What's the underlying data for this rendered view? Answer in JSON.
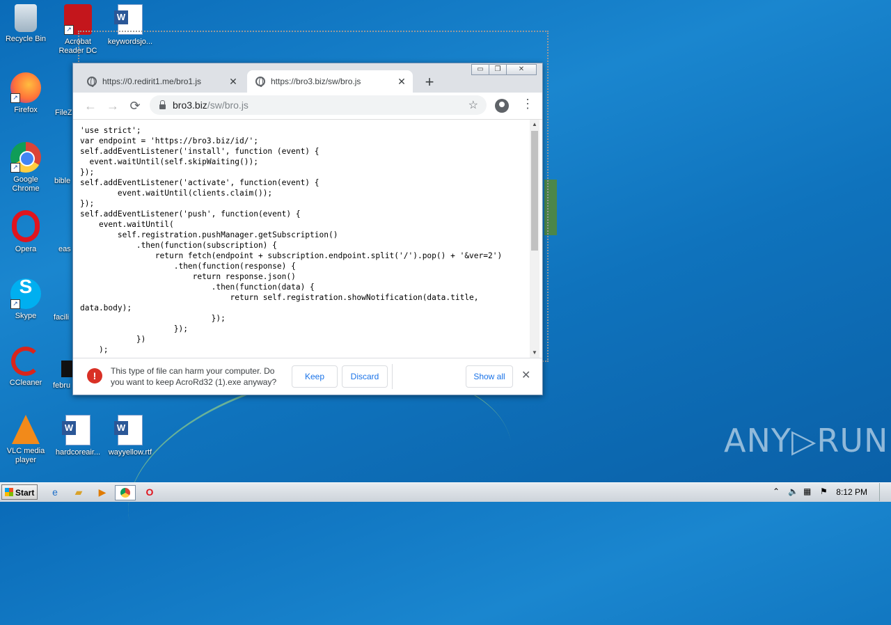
{
  "desktop": {
    "icons": [
      {
        "label": "Recycle Bin",
        "icon": "recycle-bin-icon"
      },
      {
        "label": "Acrobat Reader DC",
        "icon": "acrobat-icon"
      },
      {
        "label": "keywordsjo...",
        "icon": "word-doc-icon"
      },
      {
        "label": "Firefox",
        "icon": "firefox-icon"
      },
      {
        "label": "FileZ",
        "icon": "filezilla-icon"
      },
      {
        "label": "Google Chrome",
        "icon": "chrome-icon"
      },
      {
        "label": "bible",
        "icon": "word-doc-icon"
      },
      {
        "label": "Opera",
        "icon": "opera-icon"
      },
      {
        "label": "eas",
        "icon": "word-doc-icon"
      },
      {
        "label": "Skype",
        "icon": "skype-icon"
      },
      {
        "label": "facili",
        "icon": "word-doc-icon"
      },
      {
        "label": "CCleaner",
        "icon": "ccleaner-icon"
      },
      {
        "label": "febru",
        "icon": "file-icon"
      },
      {
        "label": "VLC media player",
        "icon": "vlc-icon"
      },
      {
        "label": "hardcoreair...",
        "icon": "word-doc-icon"
      },
      {
        "label": "wayyellow.rtf",
        "icon": "word-doc-icon"
      }
    ]
  },
  "browser": {
    "window_controls": {
      "minimize": "▭",
      "restore": "❐",
      "close": "✕"
    },
    "tabs": [
      {
        "title": "https://0.redirit1.me/bro1.js",
        "close": "✕"
      },
      {
        "title": "https://bro3.biz/sw/bro.js",
        "close": "✕"
      }
    ],
    "new_tab": "+",
    "nav": {
      "back": "←",
      "forward": "→",
      "reload": "⟳",
      "bookmark": "☆",
      "menu": "⋮"
    },
    "url_host": "bro3.biz",
    "url_path": "/sw/bro.js",
    "code": "'use strict';\nvar endpoint = 'https://bro3.biz/id/';\nself.addEventListener('install', function (event) {\n  event.waitUntil(self.skipWaiting());\n});\nself.addEventListener('activate', function(event) {\n        event.waitUntil(clients.claim());\n});\nself.addEventListener('push', function(event) {\n    event.waitUntil(\n        self.registration.pushManager.getSubscription()\n            .then(function(subscription) {\n                return fetch(endpoint + subscription.endpoint.split('/').pop() + '&ver=2')\n                    .then(function(response) {\n                        return response.json()\n                            .then(function(data) {\n                                return self.registration.showNotification(data.title, data.body);\n                            });\n                    });\n            })\n    );",
    "download_bar": {
      "message": "This type of file can harm your computer. Do you want to keep AcroRd32 (1).exe anyway?",
      "keep": "Keep",
      "discard": "Discard",
      "show_all": "Show all",
      "close": "✕"
    }
  },
  "watermark": "ANY▷RUN",
  "taskbar": {
    "start": "Start",
    "clock": "8:12 PM"
  }
}
